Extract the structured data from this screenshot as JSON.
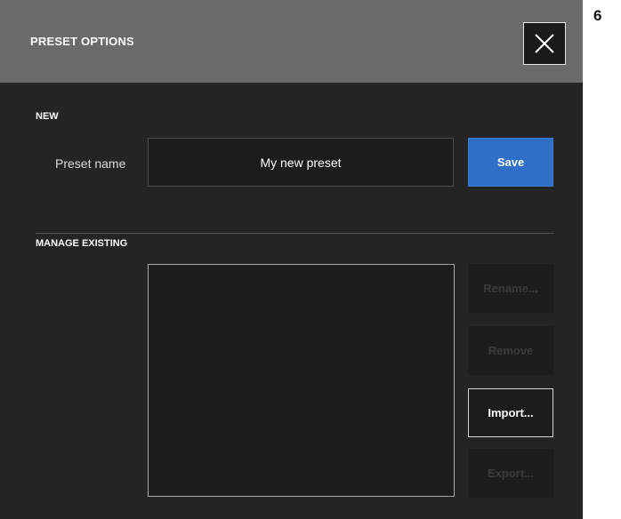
{
  "page_number": "6",
  "dialog": {
    "title": "PRESET OPTIONS",
    "close_icon": "close-icon"
  },
  "new_section": {
    "label": "NEW",
    "field_label": "Preset name",
    "input_value": "My new preset",
    "save_label": "Save"
  },
  "manage_section": {
    "label": "MANAGE EXISTING",
    "items": [],
    "buttons": {
      "rename": "Rename...",
      "remove": "Remove",
      "import": "Import...",
      "export": "Export..."
    }
  },
  "colors": {
    "titlebar": "#6a6a6a",
    "background": "#242424",
    "accent": "#2f6fc7"
  }
}
